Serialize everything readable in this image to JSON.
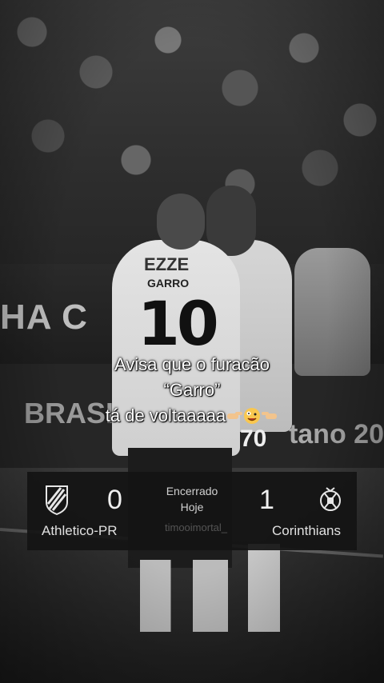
{
  "background": {
    "board_left_text": "HA C",
    "board_lower_left_text": "BRASI",
    "board_lower_right_text": "tano 20",
    "jersey": {
      "sponsor": "EZZE",
      "name": "GARRO",
      "number": "10"
    },
    "teammate_shorts_number": "70"
  },
  "caption": {
    "line1": "Avisa que o furacão",
    "line2": "“Garro”",
    "line3": "tá de voltaaaaa"
  },
  "scoreboard": {
    "home_team": "Athletico-PR",
    "home_score": "0",
    "away_team": "Corinthians",
    "away_score": "1",
    "status_line1": "Encerrado",
    "status_line2": "Hoje",
    "watermark": "timooimortal_",
    "home_crest_icon": "athletico-pr-crest-icon",
    "away_crest_icon": "corinthians-crest-icon"
  }
}
